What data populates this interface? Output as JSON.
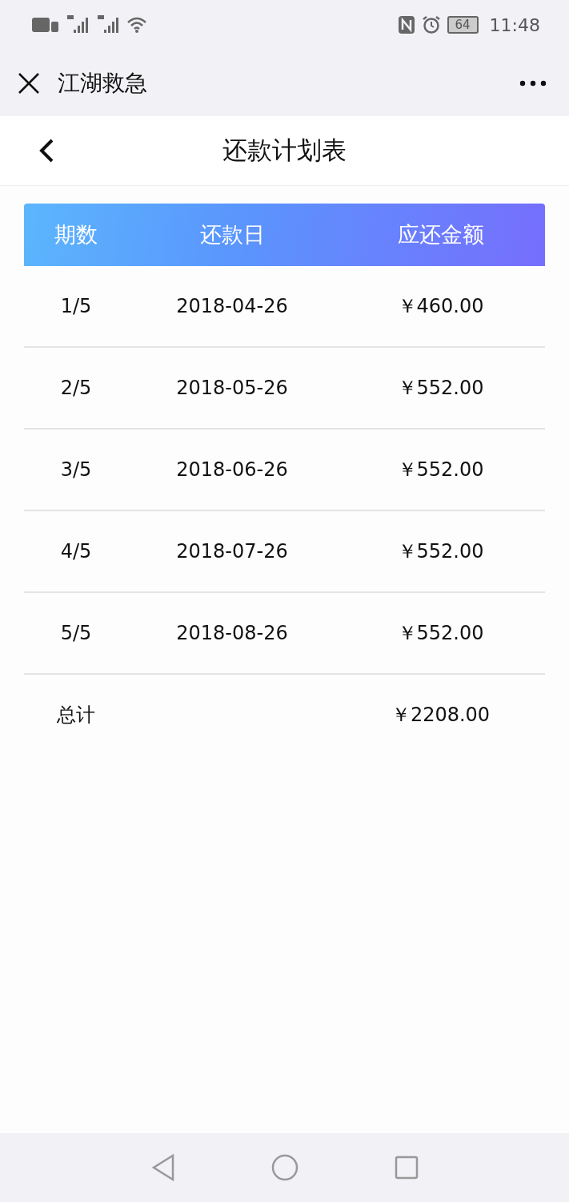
{
  "status_bar": {
    "battery": "64",
    "time": "11:48"
  },
  "title_bar": {
    "title": "江湖救急"
  },
  "page": {
    "title": "还款计划表"
  },
  "table": {
    "columns": [
      "期数",
      "还款日",
      "应还金额"
    ],
    "rows": [
      [
        "1/5",
        "2018-04-26",
        "￥460.00"
      ],
      [
        "2/5",
        "2018-05-26",
        "￥552.00"
      ],
      [
        "3/5",
        "2018-06-26",
        "￥552.00"
      ],
      [
        "4/5",
        "2018-07-26",
        "￥552.00"
      ],
      [
        "5/5",
        "2018-08-26",
        "￥552.00"
      ]
    ],
    "total": {
      "label": "总计",
      "amount": "￥2208.00"
    }
  }
}
